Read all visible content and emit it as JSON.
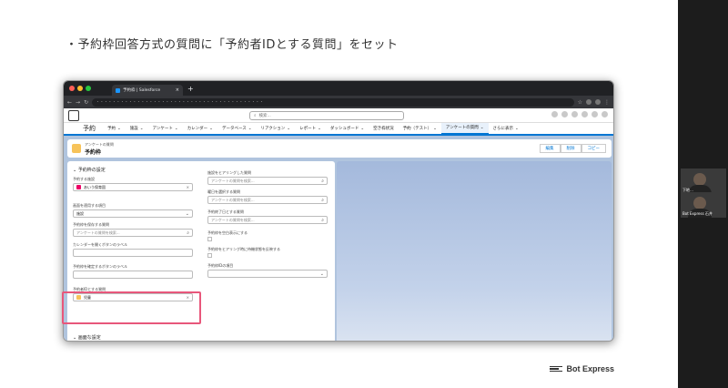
{
  "slide": {
    "title": "・予約枠回答方式の質問に「予約者IDとする質問」をセット",
    "brand": "Bot Express"
  },
  "video": {
    "tiles": [
      {
        "name": "下地…"
      },
      {
        "name": "Bot Express 石井"
      }
    ]
  },
  "browser": {
    "tab_title": "予約枠 | Salesforce",
    "url": "・・・・・・・・・・・・・・・・・・・・・・・・・・・・・・・・・・・・・・・・・"
  },
  "sf": {
    "search_placeholder": "検索...",
    "app_name": "予約",
    "nav": [
      "予約",
      "施設",
      "アンケート",
      "カレンダー",
      "データベース",
      "リアクション",
      "レポート",
      "ダッシュボード",
      "空き枠状況",
      "予約（テスト）",
      "アンケートの質問",
      "さらに表示"
    ],
    "active_nav": "アンケートの質問",
    "record_type": "アンケートの質問",
    "record_name": "予約枠",
    "buttons": [
      "編集",
      "削除",
      "コピー"
    ],
    "section_title": "予約枠の設定",
    "left_fields": [
      {
        "label": "予約する施設",
        "value": "あいう保育園"
      },
      {
        "label": "画面を適用する項目",
        "value": "施設"
      },
      {
        "label": "予約枠を保存する質問",
        "placeholder": "アンケートの質問を検索..."
      },
      {
        "label": "カレンダーを開くボタンのラベル",
        "value": ""
      },
      {
        "label": "予約枠を確定するボタンのラベル",
        "value": ""
      },
      {
        "label": "予約者IDとする質問",
        "value": "児童"
      }
    ],
    "right_fields": [
      {
        "label": "施設をヒアリングした質問",
        "placeholder": "アンケートの質問を検索..."
      },
      {
        "label": "曜日を選択する質問",
        "placeholder": "アンケートの質問を検索..."
      },
      {
        "label": "予約終了日とする質問",
        "placeholder": "アンケートの質問を検索..."
      },
      {
        "label": "予約枠を空白表示にする"
      },
      {
        "label": "予約枠をヒアリング時に待機状態を反映する"
      },
      {
        "label": "予約枠IDの項目"
      }
    ],
    "next_section": "画面な設定"
  },
  "colors": {
    "highlight": "#e8577b",
    "salesforce_blue": "#0176d3"
  }
}
